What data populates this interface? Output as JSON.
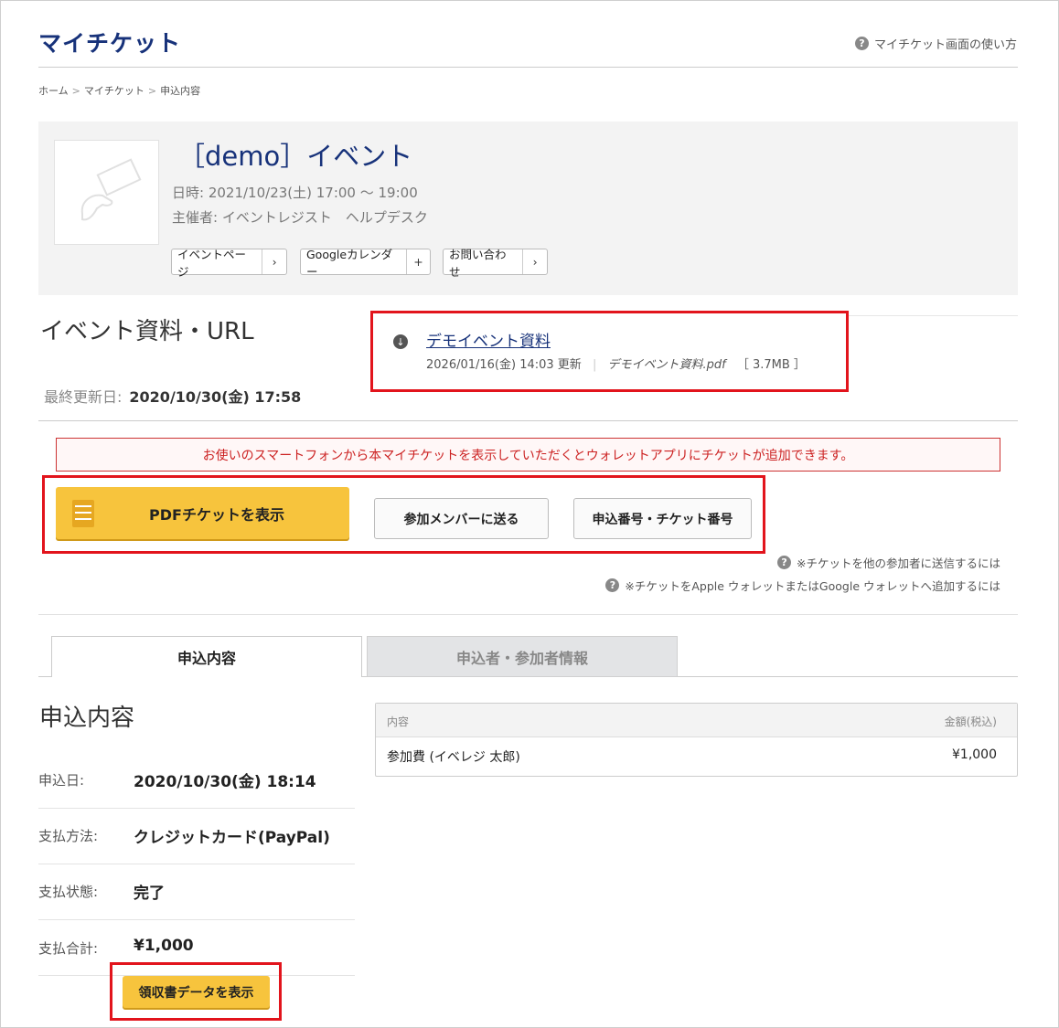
{
  "header": {
    "title": "マイチケット",
    "help_icon": "question-circle-icon",
    "help_link": "マイチケット画面の使い方"
  },
  "breadcrumb": [
    "ホーム",
    "マイチケット",
    "申込内容"
  ],
  "breadcrumb_separator": ">",
  "event": {
    "name": "［demo］イベント",
    "date": "日時: 2021/10/23(土) 17:00 ～ 19:00",
    "organizer": "主催者: イベントレジスト　ヘルプデスク",
    "buttons": [
      {
        "label": "イベントページ",
        "suffix": "›"
      },
      {
        "label": "Googleカレンダー",
        "suffix": "+"
      },
      {
        "label": "お問い合わせ",
        "suffix": "›"
      }
    ]
  },
  "materials": {
    "heading": "イベント資料・URL",
    "last_updated_label": "最終更新日:",
    "last_updated_value": "2020/10/30(金) 17:58",
    "item": {
      "link": "デモイベント資料",
      "updated": "2026/01/16(金) 14:03 更新",
      "filename": "デモイベント資料.pdf",
      "size": "［ 3.7MB ］",
      "icon": "download-icon"
    }
  },
  "notice": "お使いのスマートフォンから本マイチケットを表示していただくとウォレットアプリにチケットが追加できます。",
  "ticket_actions": {
    "pdf": "PDFチケットを表示",
    "pdf_icon": "pdf-document-icon",
    "send": "参加メンバーに送る",
    "numbers": "申込番号・チケット番号"
  },
  "notes": [
    "※チケットを他の参加者に送信するには",
    "※チケットをApple ウォレットまたはGoogle ウォレットへ追加するには"
  ],
  "tabs": [
    {
      "label": "申込内容",
      "active": true
    },
    {
      "label": "申込者・参加者情報",
      "active": false
    }
  ],
  "application": {
    "heading": "申込内容",
    "rows": [
      {
        "label": "申込日:",
        "value": "2020/10/30(金) 18:14"
      },
      {
        "label": "支払方法:",
        "value": "クレジットカード(PayPal)"
      },
      {
        "label": "支払状態:",
        "value": "完了"
      },
      {
        "label": "支払合計:",
        "value": "¥1,000"
      }
    ],
    "receipt_button": "領収書データを表示"
  },
  "table": {
    "headers": [
      "内容",
      "金額(税込)"
    ],
    "rows": [
      {
        "item": "参加費 (イベレジ 太郎)",
        "amount": "¥1,000"
      }
    ]
  },
  "colors": {
    "brand": "#17327a",
    "accent_yellow": "#f7c43d",
    "highlight_red": "#e2141c"
  }
}
